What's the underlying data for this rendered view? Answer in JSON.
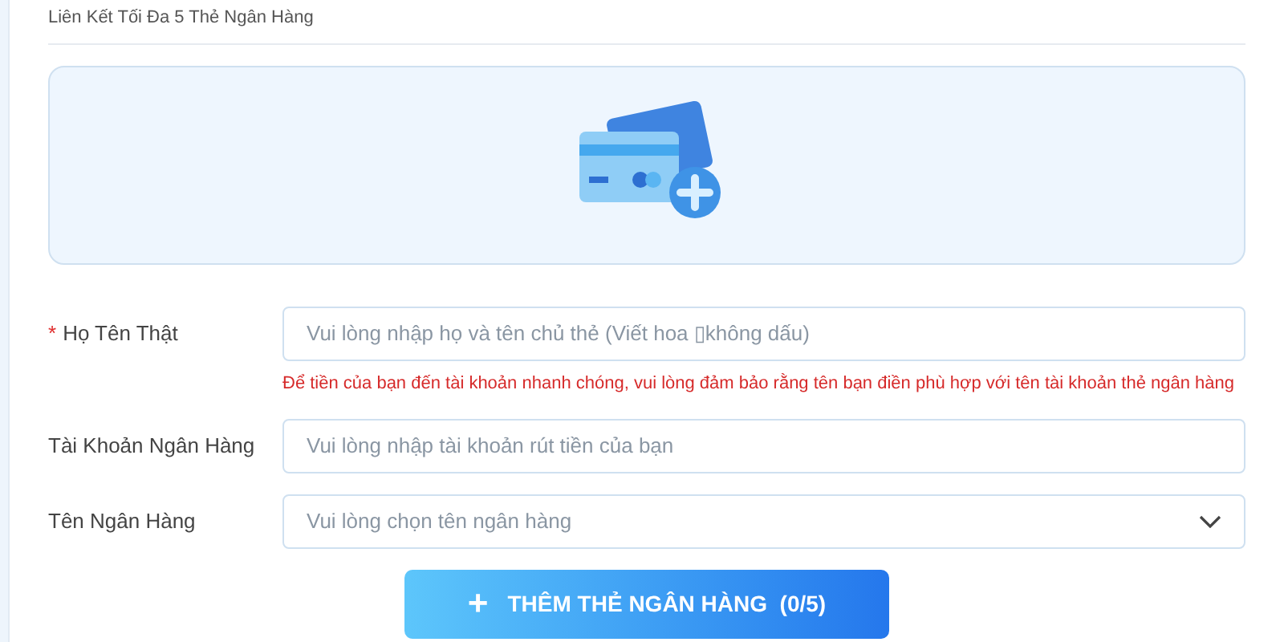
{
  "heading": "Liên Kết Tối Đa 5 Thẻ Ngân Hàng",
  "fields": [
    {
      "kind": "input",
      "required_mark": "*",
      "label": "Họ Tên Thật",
      "placeholder": "Vui lòng nhập họ và tên chủ thẻ (Viết hoa ▯không dấu)",
      "hint": "Để tiền của bạn đến tài khoản nhanh chóng, vui lòng đảm bảo rằng tên bạn điền phù hợp với tên tài khoản thẻ ngân hàng"
    },
    {
      "kind": "input",
      "label": "Tài Khoản Ngân Hàng",
      "placeholder": "Vui lòng nhập tài khoản rút tiền của bạn"
    },
    {
      "kind": "select",
      "label": "Tên Ngân Hàng",
      "placeholder": "Vui lòng chọn tên ngân hàng"
    }
  ],
  "button": {
    "icon": "+",
    "label": "THÊM THẺ NGÂN HÀNG",
    "count": "(0/5)"
  }
}
